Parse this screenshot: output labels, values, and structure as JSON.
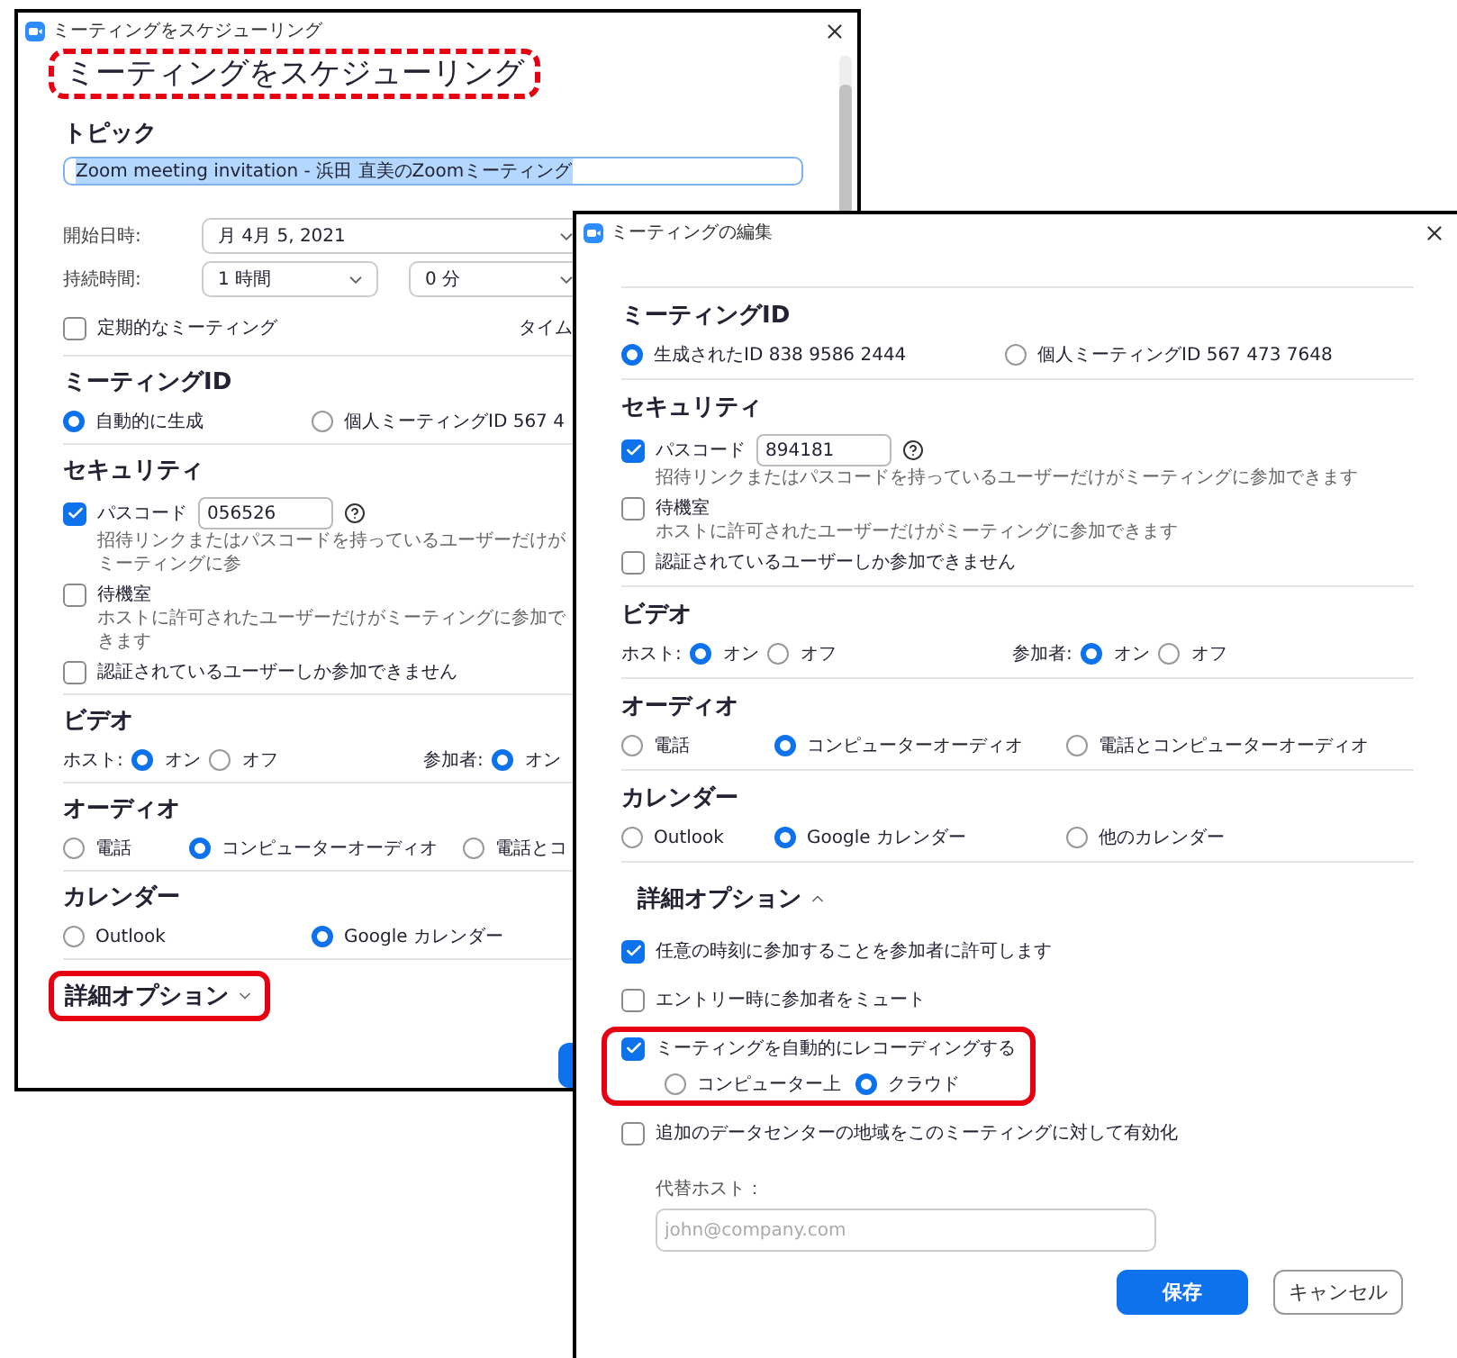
{
  "schedule_window": {
    "title": "ミーティングをスケジューリング",
    "heading": {
      "text": "ミーティングをスケジューリング",
      "highlighted": true
    },
    "topic": {
      "label": "トピック",
      "value": "Zoom meeting invitation - 浜田 直美のZoomミーティング"
    },
    "start": {
      "label": "開始日時:",
      "value": "月 4月 5, 2021"
    },
    "duration": {
      "label": "持続時間:",
      "hours": "1 時間",
      "minutes": "0 分"
    },
    "recurring": {
      "label": "定期的なミーティング",
      "checked": false
    },
    "timezone_label": "タイム",
    "sections": [
      {
        "heading": "ミーティングID",
        "rows": [
          {
            "kind": "radios",
            "options": [
              {
                "label": "自動的に生成",
                "selected": true
              },
              {
                "label": "個人ミーティングID 567 4",
                "selected": false
              }
            ]
          }
        ]
      },
      {
        "heading": "セキュリティ",
        "rows": [
          {
            "kind": "checkbox",
            "label": "パスコード",
            "checked": true,
            "value": "056526",
            "help": true,
            "description": "招待リンクまたはパスコードを持っているユーザーだけがミーティングに参"
          },
          {
            "kind": "checkbox",
            "label": "待機室",
            "checked": false,
            "description": "ホストに許可されたユーザーだけがミーティングに参加できます"
          },
          {
            "kind": "checkbox",
            "label": "認証されているユーザーしか参加できません",
            "checked": false
          }
        ]
      },
      {
        "heading": "ビデオ",
        "rows": [
          {
            "kind": "labeled_radios",
            "groups": [
              {
                "label": "ホスト:",
                "options": [
                  {
                    "label": "オン",
                    "selected": true
                  },
                  {
                    "label": "オフ",
                    "selected": false
                  }
                ]
              },
              {
                "label": "参加者:",
                "options": [
                  {
                    "label": "オン",
                    "selected": true
                  }
                ]
              }
            ]
          }
        ]
      },
      {
        "heading": "オーディオ",
        "rows": [
          {
            "kind": "radios",
            "options": [
              {
                "label": "電話",
                "selected": false
              },
              {
                "label": "コンピューターオーディオ",
                "selected": true
              },
              {
                "label": "電話とコ",
                "selected": false
              }
            ]
          }
        ]
      },
      {
        "heading": "カレンダー",
        "rows": [
          {
            "kind": "radios",
            "options": [
              {
                "label": "Outlook",
                "selected": false
              },
              {
                "label": "Google カレンダー",
                "selected": true
              }
            ]
          }
        ]
      }
    ],
    "advanced": {
      "label": "詳細オプション",
      "expanded": false,
      "highlighted": true
    }
  },
  "edit_window": {
    "title": "ミーティングの編集",
    "sections": [
      {
        "heading": "ミーティングID",
        "rows": [
          {
            "kind": "radios",
            "options": [
              {
                "label": "生成されたID 838 9586 2444",
                "selected": true
              },
              {
                "label": "個人ミーティングID 567 473 7648",
                "selected": false
              }
            ]
          }
        ]
      },
      {
        "heading": "セキュリティ",
        "rows": [
          {
            "kind": "checkbox",
            "label": "パスコード",
            "checked": true,
            "value": "894181",
            "help": true,
            "description": "招待リンクまたはパスコードを持っているユーザーだけがミーティングに参加できます"
          },
          {
            "kind": "checkbox",
            "label": "待機室",
            "checked": false,
            "description": "ホストに許可されたユーザーだけがミーティングに参加できます"
          },
          {
            "kind": "checkbox",
            "label": "認証されているユーザーしか参加できません",
            "checked": false
          }
        ]
      },
      {
        "heading": "ビデオ",
        "rows": [
          {
            "kind": "labeled_radios",
            "groups": [
              {
                "label": "ホスト:",
                "options": [
                  {
                    "label": "オン",
                    "selected": true
                  },
                  {
                    "label": "オフ",
                    "selected": false
                  }
                ]
              },
              {
                "label": "参加者:",
                "options": [
                  {
                    "label": "オン",
                    "selected": true
                  },
                  {
                    "label": "オフ",
                    "selected": false
                  }
                ]
              }
            ]
          }
        ]
      },
      {
        "heading": "オーディオ",
        "rows": [
          {
            "kind": "radios",
            "options": [
              {
                "label": "電話",
                "selected": false
              },
              {
                "label": "コンピューターオーディオ",
                "selected": true
              },
              {
                "label": "電話とコンピューターオーディオ",
                "selected": false
              }
            ]
          }
        ]
      },
      {
        "heading": "カレンダー",
        "rows": [
          {
            "kind": "radios",
            "options": [
              {
                "label": "Outlook",
                "selected": false
              },
              {
                "label": "Google カレンダー",
                "selected": true
              },
              {
                "label": "他のカレンダー",
                "selected": false
              }
            ]
          }
        ]
      }
    ],
    "advanced": {
      "label": "詳細オプション",
      "expanded": true,
      "highlighted": false,
      "options": [
        {
          "label": "任意の時刻に参加することを参加者に許可します",
          "checked": true,
          "highlighted": false
        },
        {
          "label": "エントリー時に参加者をミュート",
          "checked": false,
          "highlighted": false
        },
        {
          "label": "ミーティングを自動的にレコーディングする",
          "checked": true,
          "highlighted": true,
          "choices": [
            {
              "label": "コンピューター上",
              "selected": false
            },
            {
              "label": "クラウド",
              "selected": true
            }
          ]
        },
        {
          "label": "追加のデータセンターの地域をこのミーティングに対して有効化",
          "checked": false,
          "highlighted": false
        }
      ]
    },
    "alt_host": {
      "label": "代替ホスト：",
      "placeholder": "john@company.com"
    },
    "buttons": [
      {
        "label": "保存",
        "kind": "primary"
      },
      {
        "label": "キャンセル",
        "kind": "secondary"
      }
    ]
  }
}
